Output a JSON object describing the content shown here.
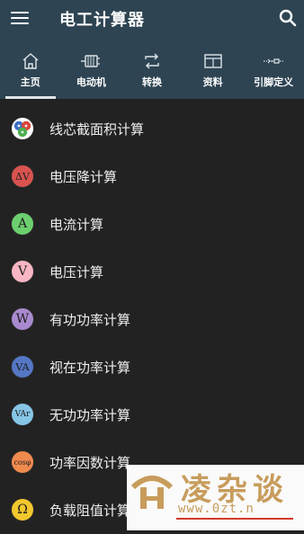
{
  "app": {
    "title": "电工计算器"
  },
  "toolbar": {
    "menu_icon": "hamburger-menu-icon",
    "search_icon": "search-icon"
  },
  "tabs": [
    {
      "label": "主页",
      "icon": "home-icon",
      "active": true
    },
    {
      "label": "电动机",
      "icon": "motor-icon",
      "active": false
    },
    {
      "label": "转换",
      "icon": "convert-icon",
      "active": false
    },
    {
      "label": "资料",
      "icon": "book-icon",
      "active": false
    },
    {
      "label": "引脚定义",
      "icon": "pinout-icon",
      "active": false
    }
  ],
  "items": [
    {
      "label": "线芯截面积计算",
      "icon": "wire-cross-section-icon",
      "symbol": "",
      "color": "#3b6fc4"
    },
    {
      "label": "电压降计算",
      "icon": "voltage-drop-icon",
      "symbol": "ΔV",
      "color": "#d9534f"
    },
    {
      "label": "电流计算",
      "icon": "current-icon",
      "symbol": "A",
      "color": "#6ccf6e"
    },
    {
      "label": "电压计算",
      "icon": "voltage-icon",
      "symbol": "V",
      "color": "#f7b6c2"
    },
    {
      "label": "有功功率计算",
      "icon": "active-power-icon",
      "symbol": "W",
      "color": "#a98ad0"
    },
    {
      "label": "视在功率计算",
      "icon": "apparent-power-icon",
      "symbol": "VA",
      "color": "#5577c4"
    },
    {
      "label": "无功功率计算",
      "icon": "reactive-power-icon",
      "symbol": "VAr",
      "color": "#86c6e6"
    },
    {
      "label": "功率因数计算",
      "icon": "power-factor-icon",
      "symbol": "cosφ",
      "color": "#f08a4e"
    },
    {
      "label": "负载阻值计算",
      "icon": "resistance-icon",
      "symbol": "Ω",
      "color": "#f2c72e"
    }
  ],
  "watermark": {
    "brand": "凌杂谈",
    "url": "www.0zt.n"
  }
}
